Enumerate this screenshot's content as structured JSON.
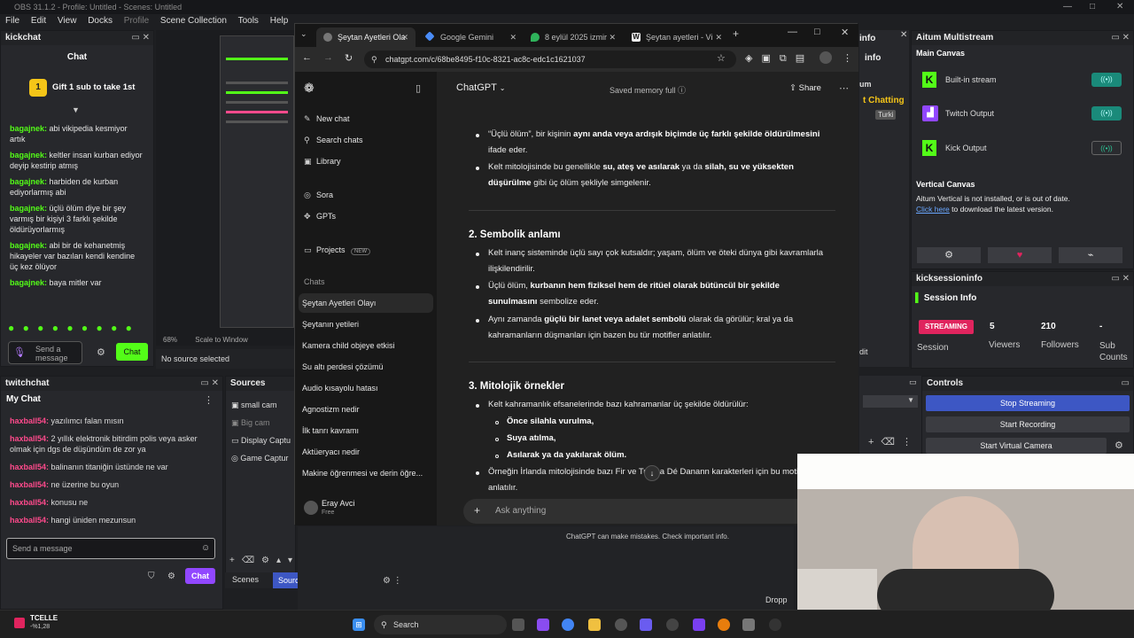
{
  "obs": {
    "title": "OBS 31.1.2 - Profile: Untitled - Scenes: Untitled",
    "menu": [
      "File",
      "Edit",
      "View",
      "Docks",
      "Profile",
      "Scene Collection",
      "Tools",
      "Help"
    ],
    "kickchat": {
      "dock_title": "kickchat",
      "chat_label": "Chat",
      "gift_text": "Gift 1 sub to take 1st",
      "messages": [
        {
          "user": "bagajnek:",
          "text": "abi vikipedia kesmiyor artık"
        },
        {
          "user": "bagajnek:",
          "text": "keltler insan kurban ediyor deyip kestirip atmış"
        },
        {
          "user": "bagajnek:",
          "text": "harbiden de kurban ediyorlarmış abi"
        },
        {
          "user": "bagajnek:",
          "text": "üçlü ölüm diye bir şey varmış bir kişiyi 3 farklı şekilde öldürüyorlarmış"
        },
        {
          "user": "bagajnek:",
          "text": "abi bir de kehanetmiş hikayeler var bazıları kendi kendine üç kez ölüyor"
        },
        {
          "user": "bagajnek:",
          "text": "baya mitler var"
        }
      ],
      "input_placeholder": "Send a message",
      "chat_button": "Chat"
    },
    "preview": {
      "zoom": "68%",
      "scale_label": "Scale to Window",
      "no_source": "No source selected"
    },
    "twitchchat": {
      "dock_title": "twitchchat",
      "header": "My Chat",
      "messages": [
        {
          "user": "haxball54:",
          "text": "yazılımcı falan mısın"
        },
        {
          "user": "haxball54:",
          "text": "2 yıllık elektronik bitirdim polis veya asker olmak için dgs de düşündüm de zor ya"
        },
        {
          "user": "haxball54:",
          "text": "balinanın titaniğin üstünde ne var"
        },
        {
          "user": "haxball54:",
          "text": "ne üzerine bu oyun"
        },
        {
          "user": "haxball54:",
          "text": "konusu ne"
        },
        {
          "user": "haxball54:",
          "text": "hangi üniden mezunsun"
        }
      ],
      "input_placeholder": "Send a message",
      "chat_button": "Chat"
    },
    "sources": {
      "dock_title": "Sources",
      "items": [
        "small cam",
        "Big cam",
        "Display Captu",
        "Game Captur"
      ],
      "tabs": [
        "Scenes",
        "Sources"
      ]
    },
    "multistream": {
      "dock_title": "Aitum Multistream",
      "main_canvas": "Main Canvas",
      "outputs": [
        "Built-in stream",
        "Twitch Output",
        "Kick Output"
      ],
      "vertical_canvas": "Vertical Canvas",
      "vertical_msg": "Aitum Vertical is not installed, or is out of date.",
      "click_here": "Click here",
      "download_msg": " to download the latest version."
    },
    "session": {
      "dock_title": "kicksessioninfo",
      "header": "Session Info",
      "status": "STREAMING",
      "session_label": "Session",
      "viewers": "5",
      "viewers_label": "Viewers",
      "followers": "210",
      "followers_label": "Followers",
      "subs": "-",
      "subs_label": "Sub Counts"
    },
    "controls": {
      "dock_title": "Controls",
      "stop_streaming": "Stop Streaming",
      "start_recording": "Start Recording",
      "start_virtual": "Start Virtual Camera"
    },
    "partial": {
      "info": "info",
      "info2": "info",
      "chatting": "t Chatting",
      "turkish": "Turki",
      "um": "um",
      "dit": "dit",
      "dropped": "Dropp"
    }
  },
  "browser": {
    "tabs": [
      {
        "label": "Şeytan Ayetleri Ola",
        "color": "#aaaaaa"
      },
      {
        "label": "Google Gemini",
        "color": "#4a8cf7"
      },
      {
        "label": "8 eylül 2025 izmir",
        "color": "#2fb35b"
      },
      {
        "label": "Şeytan ayetleri - Vi",
        "color": "#eeeeee"
      }
    ],
    "url": "chatgpt.com/c/68be8495-f10c-8321-ac8c-edc1c1621037"
  },
  "chatgpt": {
    "sidebar": {
      "new_chat": "New chat",
      "search_chats": "Search chats",
      "library": "Library",
      "sora": "Sora",
      "gpts": "GPTs",
      "projects": "Projects",
      "new_badge": "NEW",
      "chats_label": "Chats",
      "chats": [
        "Şeytan Ayetleri Olayı",
        "Şeytanın yetileri",
        "Kamera child objeye etkisi",
        "Su altı perdesi çözümü",
        "Audio kısayolu hatası",
        "Agnostizm nedir",
        "İlk tanrı kavramı",
        "Aktüeryacı nedir",
        "Makine öğrenmesi ve derin öğre..."
      ],
      "user_name": "Eray Avci",
      "user_plan": "Free"
    },
    "header": {
      "model": "ChatGPT",
      "memory": "Saved memory full",
      "share": "Share"
    },
    "content": {
      "b1_pre": "“Üçlü ölüm”, bir kişinin ",
      "b1_bold": "aynı anda veya ardışık biçimde üç farklı şekilde öldürülmesini",
      "b1_post": " ifade eder.",
      "b2_pre": "Kelt mitolojisinde bu genellikle ",
      "b2_bold": "su, ateş ve asılarak",
      "b2_mid": " ya da ",
      "b2_bold2": "silah, su ve yüksekten düşürülme",
      "b2_post": " gibi üç ölüm şekliyle simgelenir.",
      "h2": "2. Sembolik anlamı",
      "s1": "Kelt inanç sisteminde üçlü sayı çok kutsaldır; yaşam, ölüm ve öteki dünya gibi kavramlarla ilişkilendirilir.",
      "s2_pre": "Üçlü ölüm, ",
      "s2_bold": "kurbanın hem fiziksel hem de ritüel olarak bütüncül bir şekilde sunulmasını",
      "s2_post": " sembolize eder.",
      "s3_pre": "Aynı zamanda ",
      "s3_bold": "güçlü bir lanet veya adalet sembolü",
      "s3_post": " olarak da görülür; kral ya da kahramanların düşmanları için bazen bu tür motifler anlatılır.",
      "h3": "3. Mitolojik örnekler",
      "m1": "Kelt kahramanlık efsanelerinde bazı kahramanlar üç şekilde öldürülür:",
      "sub": [
        "Önce silahla vurulma,",
        "Suya atılma,",
        "Asılarak ya da yakılarak ölüm."
      ],
      "m2": "Örneğin İrlanda mitolojisinde bazı Fir  ve Tuatha Dé Danann karakterleri için bu motif anlatılır."
    },
    "input_placeholder": "Ask anything",
    "disclaimer": "ChatGPT can make mistakes. Check important info."
  },
  "taskbar": {
    "search": "Search",
    "profile_name": "TCELLE",
    "profile_val": "-%1,28"
  }
}
